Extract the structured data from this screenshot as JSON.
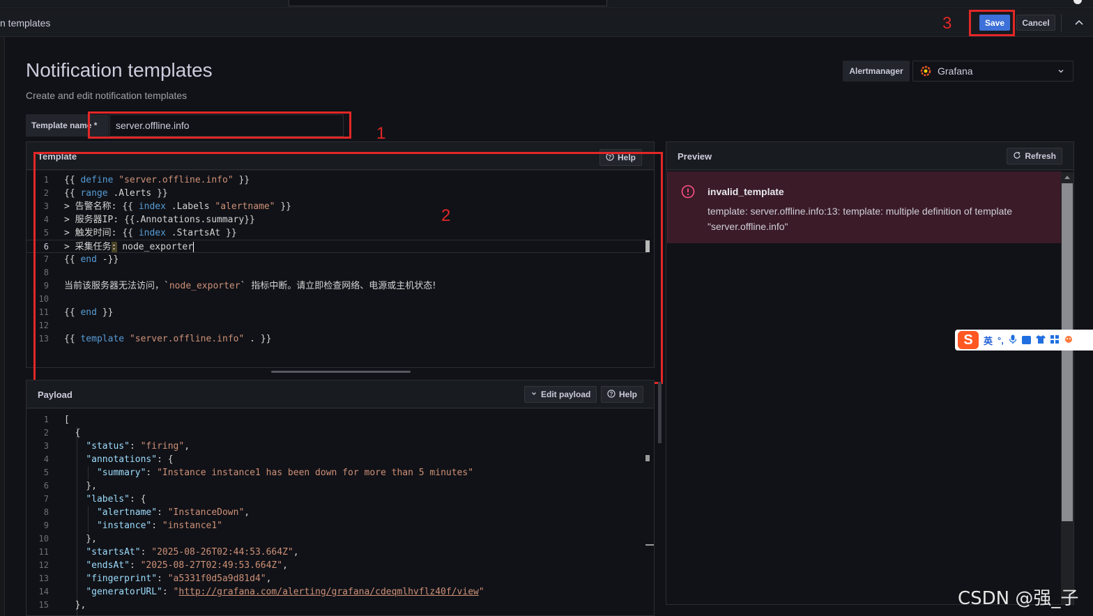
{
  "header": {
    "breadcrumb": "n templates",
    "save_label": "Save",
    "cancel_label": "Cancel"
  },
  "annotations": {
    "one": "1",
    "two": "2",
    "three": "3"
  },
  "page": {
    "title": "Notification templates",
    "subtitle": "Create and edit notification templates"
  },
  "alertmanager": {
    "label": "Alertmanager",
    "selected": "Grafana"
  },
  "template_name": {
    "label": "Template name *",
    "value": "server.offline.info"
  },
  "template_panel": {
    "title": "Template",
    "help_label": "Help"
  },
  "payload_panel": {
    "title": "Payload",
    "edit_label": "Edit payload",
    "help_label": "Help"
  },
  "preview_panel": {
    "title": "Preview",
    "refresh_label": "Refresh",
    "error_title": "invalid_template",
    "error_message": "template: server.offline.info:13: template: multiple definition of template \"server.offline.info\""
  },
  "template_code": [
    "{{ define \"server.offline.info\" }}",
    "{{ range .Alerts }}",
    "> 告警名称: {{ index .Labels \"alertname\" }}",
    "> 服务器IP: {{.Annotations.summary}}",
    "> 触发时间: {{ index .StartsAt }}",
    "> 采集任务: node_exporter",
    "{{ end -}}",
    "",
    "当前该服务器无法访问，`node_exporter` 指标中断。请立即检查网络、电源或主机状态!",
    "",
    "{{ end }}",
    "",
    "{{ template \"server.offline.info\" . }}"
  ],
  "payload_code": [
    "[",
    "  {",
    "    \"status\": \"firing\",",
    "    \"annotations\": {",
    "      \"summary\": \"Instance instance1 has been down for more than 5 minutes\"",
    "    },",
    "    \"labels\": {",
    "      \"alertname\": \"InstanceDown\",",
    "      \"instance\": \"instance1\"",
    "    },",
    "    \"startsAt\": \"2025-08-26T02:44:53.664Z\",",
    "    \"endsAt\": \"2025-08-27T02:49:53.664Z\",",
    "    \"fingerprint\": \"a5331f0d5a9d81d4\",",
    "    \"generatorURL\": \"http://grafana.com/alerting/grafana/cdeqmlhvflz40f/view\"",
    "  },"
  ],
  "ime_toolbar": {
    "mode": "英",
    "punct": "°,"
  },
  "watermark": "CSDN @强_子",
  "colors": {
    "primary": "#3d71d9",
    "annotation_red": "#e32727",
    "error_bg": "#3a1b27"
  }
}
